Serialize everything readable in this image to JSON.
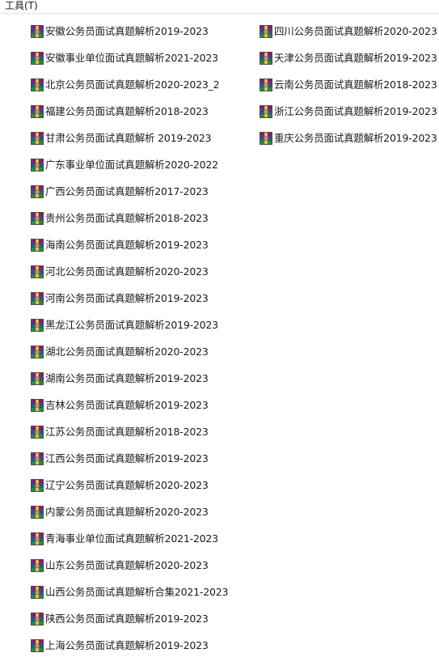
{
  "menubar": {
    "tools_label": "工具(T)"
  },
  "file_icon": "winrar-archive-icon",
  "files_col1": [
    "安徽公务员面试真题解析2019-2023",
    "安徽事业单位面试真题解析2021-2023",
    "北京公务员面试真题解析2020-2023_2",
    "福建公务员面试真题解析2018-2023",
    "甘肃公务员面试真题解析 2019-2023",
    "广东事业单位面试真题解析2020-2022",
    "广西公务员面试真题解析2017-2023",
    "贵州公务员面试真题解析2018-2023",
    "海南公务员面试真题解析2019-2023",
    "河北公务员面试真题解析2020-2023",
    "河南公务员面试真题解析2019-2023",
    "黑龙江公务员面试真题解析2019-2023",
    "湖北公务员面试真题解析2020-2023",
    "湖南公务员面试真题解析2019-2023",
    "吉林公务员面试真题解析2019-2023",
    "江苏公务员面试真题解析2018-2023",
    "江西公务员面试真题解析2019-2023",
    "辽宁公务员面试真题解析2020-2023",
    "内蒙公务员面试真题解析2020-2023",
    "青海事业单位面试真题解析2021-2023",
    "山东公务员面试真题解析2020-2023",
    "山西公务员面试真题解析合集2021-2023",
    "陕西公务员面试真题解析2019-2023",
    "上海公务员面试真题解析2019-2023"
  ],
  "files_col2": [
    "四川公务员面试真题解析2020-2023",
    "天津公务员面试真题解析2019-2023",
    "云南公务员面试真题解析2018-2023",
    "浙江公务员面试真题解析2019-2023",
    "重庆公务员面试真题解析2019-2023"
  ]
}
